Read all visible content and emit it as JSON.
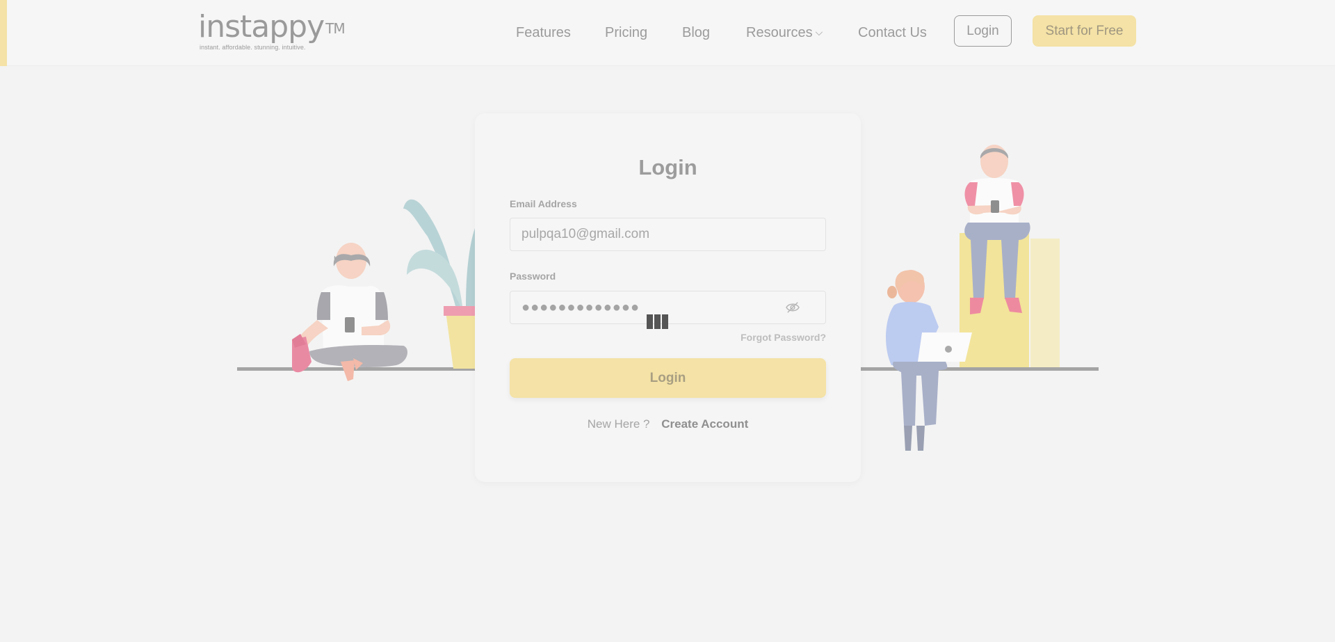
{
  "header": {
    "logo": {
      "wordmark": "instappy",
      "trademark": "TM",
      "tagline": "instant. affordable. stunning. intuitive."
    },
    "nav": [
      {
        "label": "Features"
      },
      {
        "label": "Pricing"
      },
      {
        "label": "Blog"
      },
      {
        "label": "Resources",
        "has_dropdown": true
      },
      {
        "label": "Contact Us"
      }
    ],
    "login_label": "Login",
    "start_label": "Start for Free"
  },
  "login_form": {
    "title": "Login",
    "email": {
      "label": "Email Address",
      "value": "pulpqa10@gmail.com"
    },
    "password": {
      "label": "Password",
      "masked_value": "●●●●●●●●●●●●●",
      "toggle_icon": "eye-slash-icon"
    },
    "forgot_label": "Forgot Password?",
    "submit_label": "Login",
    "signup_prompt": "New Here ?",
    "signup_link": "Create Account"
  },
  "colors": {
    "accent_yellow": "#f4e2a6",
    "background": "#f3f3f3",
    "text_gray": "#9a9a9a"
  }
}
